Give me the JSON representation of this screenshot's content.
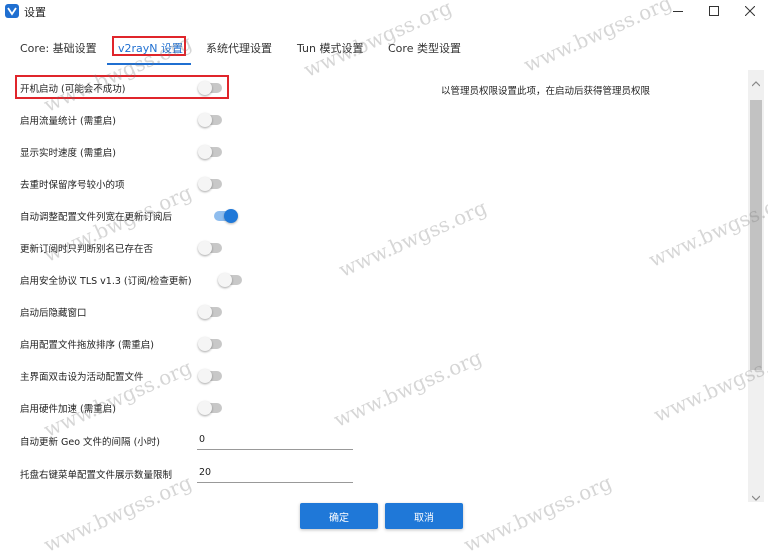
{
  "window": {
    "title": "设置",
    "icon": "v2rayn-icon",
    "controls": [
      "minimize-icon",
      "maximize-icon",
      "close-icon"
    ]
  },
  "tabs": [
    {
      "label": "Core: 基础设置",
      "active": false
    },
    {
      "label": "v2rayN 设置",
      "active": true
    },
    {
      "label": "系统代理设置",
      "active": false
    },
    {
      "label": "Tun 模式设置",
      "active": false
    },
    {
      "label": "Core 类型设置",
      "active": false
    }
  ],
  "settings": [
    {
      "label": "开机启动 (可能会不成功)",
      "on": false
    },
    {
      "label": "启用流量统计 (需重启)",
      "on": false
    },
    {
      "label": "显示实时速度 (需重启)",
      "on": false
    },
    {
      "label": "去重时保留序号较小的项",
      "on": false
    },
    {
      "label": "自动调整配置文件列宽在更新订阅后",
      "on": true
    },
    {
      "label": "更新订阅时只判断别名已存在否",
      "on": false
    },
    {
      "label": "启用安全协议 TLS v1.3 (订阅/检查更新)",
      "on": false
    },
    {
      "label": "启动后隐藏窗口",
      "on": false
    },
    {
      "label": "启用配置文件拖放排序 (需重启)",
      "on": false
    },
    {
      "label": "主界面双击设为活动配置文件",
      "on": false
    },
    {
      "label": "启用硬件加速 (需重启)",
      "on": false
    }
  ],
  "hint": "以管理员权限设置此项，在启动后获得管理员权限",
  "fields": [
    {
      "label": "自动更新 Geo 文件的间隔 (小时)",
      "value": "0"
    },
    {
      "label": "托盘右键菜单配置文件展示数量限制",
      "value": "20"
    }
  ],
  "buttons": {
    "ok": "确定",
    "cancel": "取消"
  },
  "colors": {
    "accent": "#1f78d8",
    "highlight": "#e0252b"
  },
  "watermark": "www.bwgss.org"
}
